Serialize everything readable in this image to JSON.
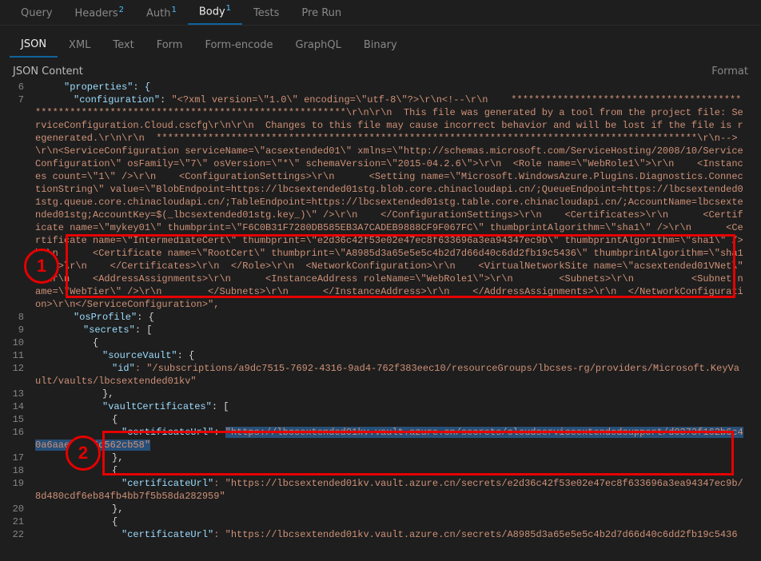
{
  "topTabs": {
    "query": "Query",
    "headers": "Headers",
    "headersBadge": "2",
    "auth": "Auth",
    "authBadge": "1",
    "body": "Body",
    "bodyBadge": "1",
    "tests": "Tests",
    "prerun": "Pre Run"
  },
  "subTabs": {
    "json": "JSON",
    "xml": "XML",
    "text": "Text",
    "form": "Form",
    "formEncode": "Form-encode",
    "graphql": "GraphQL",
    "binary": "Binary"
  },
  "contentHeader": {
    "label": "JSON Content",
    "format": "Format"
  },
  "annotations": {
    "marker1": "1",
    "marker2": "2"
  },
  "lines": {
    "n6": "6",
    "l6a": "\"properties\": {",
    "n7": "7",
    "l7key": "\"configuration\"",
    "l7c": ": ",
    "l7v": "\"<?xml version=\\\"1.0\\\" encoding=\\\"utf-8\\\"?>\\r\\n<!--\\r\\n    **********************************************************************************************\\r\\n\\r\\n  This file was generated by a tool from the project file: ServiceConfiguration.Cloud.cscfg\\r\\n\\r\\n  Changes to this file may cause incorrect behavior and will be lost if the file is regenerated.\\r\\n\\r\\n  **********************************************************************************************\\r\\n-->\\r\\n<ServiceConfiguration serviceName=\\\"acsextended01\\\" xmlns=\\\"http://schemas.microsoft.com/ServiceHosting/2008/10/ServiceConfiguration\\\" osFamily=\\\"7\\\" osVersion=\\\"*\\\" schemaVersion=\\\"2015-04.2.6\\\">\\r\\n  <Role name=\\\"WebRole1\\\">\\r\\n    <Instances count=\\\"1\\\" />\\r\\n    <ConfigurationSettings>\\r\\n      <Setting name=\\\"Microsoft.WindowsAzure.Plugins.Diagnostics.ConnectionString\\\" value=\\\"BlobEndpoint=https://lbcsextended01stg.blob.core.chinacloudapi.cn/;QueueEndpoint=https://lbcsextended01stg.queue.core.chinacloudapi.cn/;TableEndpoint=https://lbcsextended01stg.table.core.chinacloudapi.cn/;AccountName=lbcsextended01stg;AccountKey=$(_lbcsextended01stg.key_)\\\" />\\r\\n    </ConfigurationSettings>\\r\\n    ",
    "l7box": "<Certificates>\\r\\n      <Certificate name=\\\"mykey01\\\" thumbprint=\\\"F6C0B31F7280DB585EB3A7CADEB9888CF9F067FC\\\" thumbprintAlgorithm=\\\"sha1\\\" />\\r\\n      <Certificate name=\\\"IntermediateCert\\\" thumbprint=\\\"e2d36c42f53e02e47ec8f633696a3ea94347ec9b\\\" thumbprintAlgorithm=\\\"sha1\\\" />\\r\\n      <Certificate name=\\\"RootCert\\\" thumbprint=\\\"A8985d3a65e5e5c4b2d7d66d40c6dd2fb19c5436\\\" thumbprintAlgorithm=\\\"sha1\\\" />\\r\\n    </Certificates>\\r\\n  </Role",
    "l7after": ">\\r\\n  <NetworkConfiguration>\\r\\n    <VirtualNetworkSite name=\\\"acsextended01VNet\\\" />\\r\\n    <AddressAssignments>\\r\\n      <InstanceAddress roleName=\\\"WebRole1\\\">\\r\\n        <Subnets>\\r\\n          <Subnet name=\\\"WebTier\\\" />\\r\\n        </Subnets>\\r\\n      </InstanceAddress>\\r\\n    </AddressAssignments>\\r\\n  </NetworkConfiguration>\\r\\n</ServiceConfiguration>\",",
    "n8": "8",
    "l8k": "\"osProfile\"",
    "l8v": ": {",
    "n9": "9",
    "l9k": "\"secrets\"",
    "l9v": ": [",
    "n10": "10",
    "l10": "{",
    "n11": "11",
    "l11k": "\"sourceVault\"",
    "l11v": ": {",
    "n12": "12",
    "l12k": "\"id\"",
    "l12v": ": \"/subscriptions/a9dc7515-7692-4316-9ad4-762f383eec10/resourceGroups/lbcses-rg/providers/Microsoft.KeyVault/vaults/lbcsextended01kv\"",
    "n13": "13",
    "l13": "},",
    "n14": "14",
    "l14k": "\"vaultCertificates\"",
    "l14v": ": [",
    "n15": "15",
    "l15": "{",
    "n16": "16",
    "l16k": "\"certificateUrl\"",
    "l16c": ": ",
    "l16v": "\"https://lbcsextended01kv.vault.azure.cn/secrets/cloudserviceextendedsupport/d0373f162b6c40a6aae65234d562cb58\"",
    "n17": "17",
    "l17": "},",
    "n18": "18",
    "l18": "{",
    "n19": "19",
    "l19k": "\"certificateUrl\"",
    "l19v": ": \"https://lbcsextended01kv.vault.azure.cn/secrets/e2d36c42f53e02e47ec8f633696a3ea94347ec9b/8d480cdf6eb84fb4bb7f5b58da282959\"",
    "n20": "20",
    "l20": "},",
    "n21": "21",
    "l21": "{",
    "n22": "22",
    "l22k": "\"certificateUrl\"",
    "l22v": ": \"https://lbcsextended01kv.vault.azure.cn/secrets/A8985d3a65e5e5c4b2d7d66d40c6dd2fb19c5436"
  }
}
